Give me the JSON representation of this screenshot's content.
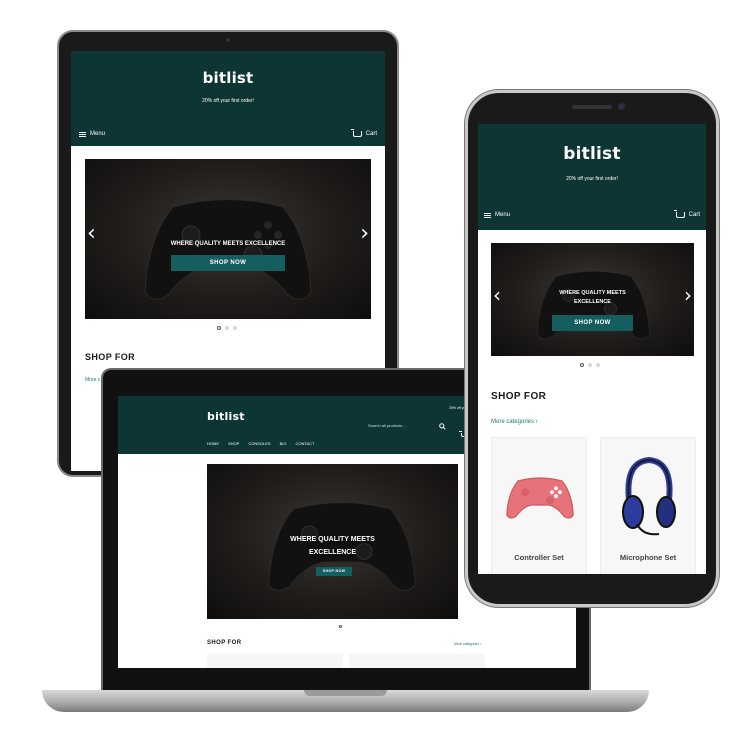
{
  "brand": {
    "logo": "bitlist",
    "promo": "20% off your first order!"
  },
  "mobile_nav": {
    "menu_label": "Menu",
    "cart_label": "Cart"
  },
  "hero": {
    "headline": "WHERE QUALITY MEETS EXCELLENCE",
    "headline_line1": "WHERE QUALITY MEETS",
    "headline_line2": "EXCELLENCE",
    "cta": "SHOP NOW",
    "prev_arrow": "‹",
    "next_arrow": "›",
    "slide_count": 3,
    "active_slide": 1
  },
  "desktop": {
    "search_placeholder": "Search all products...",
    "nav": [
      "HOME",
      "SHOP",
      "CONSOLES",
      "BIG",
      "CONTACT"
    ]
  },
  "shop_for": {
    "title": "SHOP FOR",
    "more_link": "More categories ›",
    "tablet_more_fragment": "More c"
  },
  "categories": [
    {
      "name": "Controller Set",
      "icon": "controller-icon",
      "color": "#e8727a"
    },
    {
      "name": "Microphone Set",
      "icon": "headset-icon",
      "color": "#2b3c9e"
    }
  ],
  "colors": {
    "header": "#0d3533",
    "button": "#145e60",
    "link": "#1e7a6e"
  }
}
